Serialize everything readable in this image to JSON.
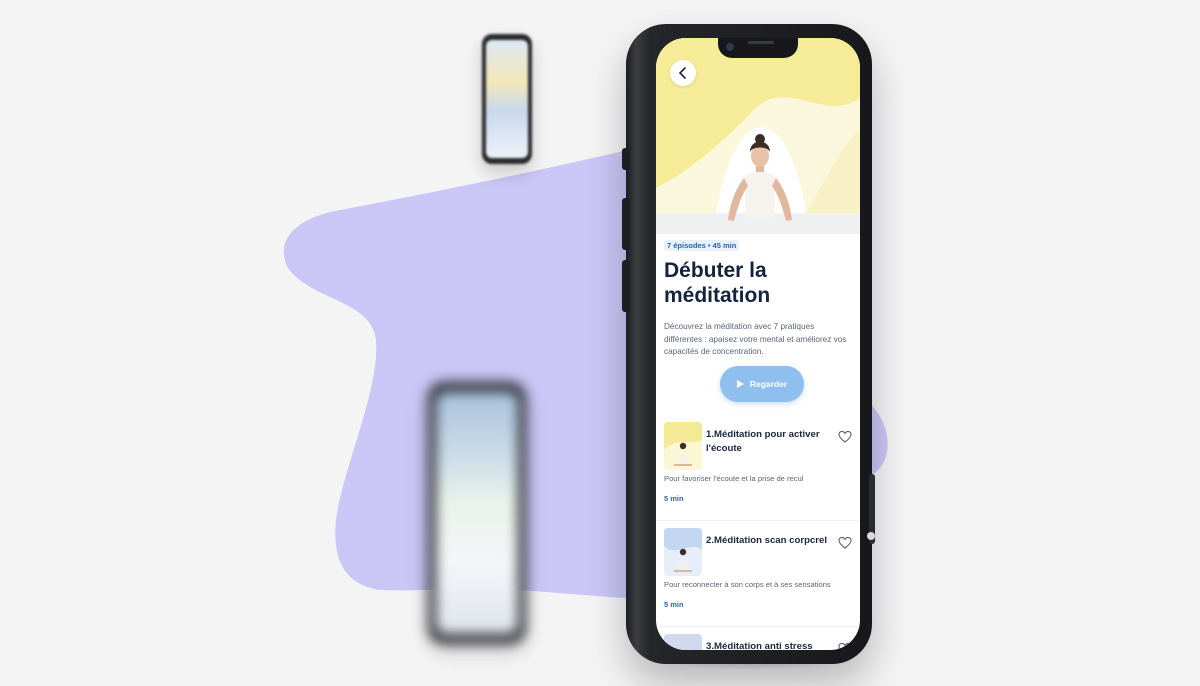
{
  "course": {
    "meta": "7 épisodes • 45 min",
    "title": "Débuter la méditation",
    "description": "Découvrez la méditation avec 7 pratiques différentes : apaisez votre mental et améliorez vos capacités de concentration.",
    "watch_label": "Regarder"
  },
  "episodes": [
    {
      "title": "1.Méditation pour activer l'écoute",
      "description": "Pour favoriser l'écoute et la prise de recul",
      "duration": "5 min"
    },
    {
      "title": "2.Méditation scan corpcrel",
      "description": "Pour reconnecter à son corps et à ses sensations",
      "duration": "5 min"
    },
    {
      "title": "3.Méditation anti stress"
    }
  ],
  "colors": {
    "background": "#f4f4f5",
    "blob": "#cac6f6",
    "hero_yellow": "#f7ee9c",
    "accent_blue": "#8ebfee",
    "title_navy": "#16233e",
    "meta_blue": "#2e63a6"
  },
  "icons": {
    "back": "chevron-left-icon",
    "play": "play-icon",
    "favorite": "heart-outline-icon"
  }
}
